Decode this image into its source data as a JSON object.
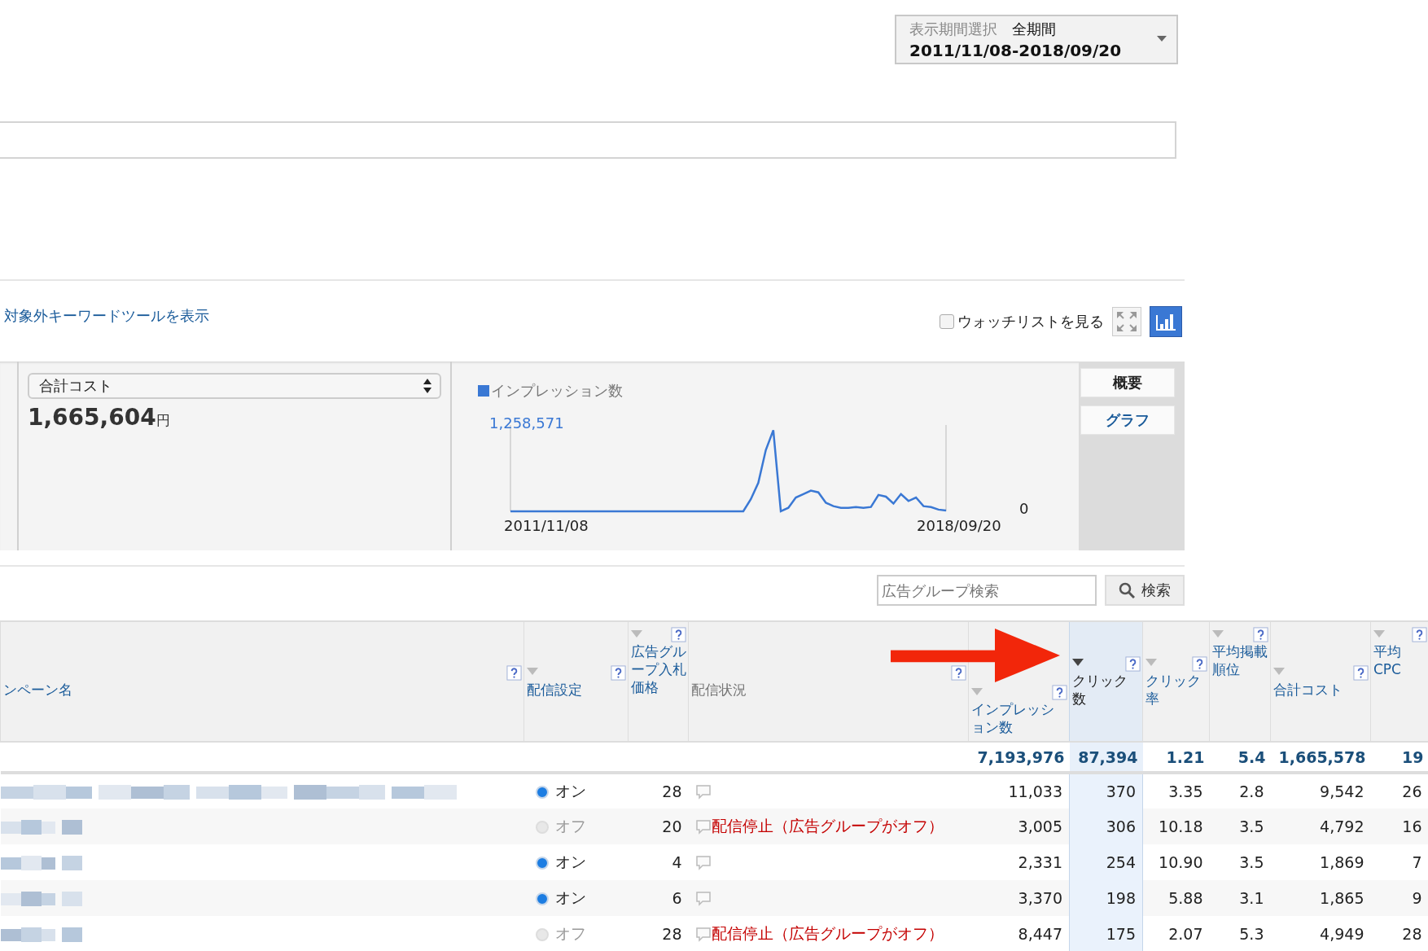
{
  "period_selector": {
    "label": "表示期間選択",
    "value": "全期間",
    "range": "2011/11/08-2018/09/20"
  },
  "keyword_link": "対象外キーワードツールを表示",
  "watchlist": {
    "label": "ウォッチリストを見る",
    "checked": false
  },
  "view_buttons": [
    {
      "kind": "expand",
      "selected": false
    },
    {
      "kind": "chart",
      "selected": true
    }
  ],
  "summary": {
    "metric": "合計コスト",
    "value": "1,665,604",
    "unit": "円"
  },
  "chart": {
    "legend": "インプレッション数",
    "max_label": "1,258,571",
    "min_label": "0",
    "start_label": "2011/11/08",
    "end_label": "2018/09/20"
  },
  "side_tabs": [
    {
      "label": "概要",
      "selected": false
    },
    {
      "label": "グラフ",
      "selected": true
    }
  ],
  "search": {
    "placeholder": "広告グループ検索",
    "button": "検索"
  },
  "table": {
    "columns": [
      {
        "label": "ンペーン名",
        "link": true,
        "sortable": false,
        "sorted": false
      },
      {
        "label": "配信設定",
        "link": true,
        "sortable": true,
        "sorted": false
      },
      {
        "label": "広告グループ入札価格",
        "link": true,
        "sortable": true,
        "sorted": false
      },
      {
        "label": "配信状況",
        "link": false,
        "sortable": false,
        "sorted": false
      },
      {
        "label": "インプレッション数",
        "link": true,
        "sortable": true,
        "sorted": false
      },
      {
        "label": "クリック数",
        "link": true,
        "sortable": true,
        "sorted": true
      },
      {
        "label": "クリック率",
        "link": true,
        "sortable": true,
        "sorted": false
      },
      {
        "label": "平均掲載順位",
        "link": true,
        "sortable": true,
        "sorted": false
      },
      {
        "label": "合計コスト",
        "link": true,
        "sortable": true,
        "sorted": false
      },
      {
        "label": "平均CPC",
        "link": true,
        "sortable": true,
        "sorted": false
      }
    ],
    "totals": [
      "7,193,976",
      "87,394",
      "1.21",
      "5.4",
      "1,665,578",
      "19"
    ],
    "rows": [
      {
        "on": true,
        "setting": "オン",
        "bid": "28",
        "metrics": [
          "11,033",
          "370",
          "3.35",
          "2.8",
          "9,542",
          "26"
        ]
      },
      {
        "on": false,
        "setting": "オフ",
        "bid": "20",
        "status": "配信停止（広告グループがオフ）",
        "metrics": [
          "3,005",
          "306",
          "10.18",
          "3.5",
          "4,792",
          "16"
        ]
      },
      {
        "on": true,
        "setting": "オン",
        "bid": "4",
        "metrics": [
          "2,331",
          "254",
          "10.90",
          "3.5",
          "1,869",
          "7"
        ]
      },
      {
        "on": true,
        "setting": "オン",
        "bid": "6",
        "metrics": [
          "3,370",
          "198",
          "5.88",
          "3.1",
          "1,865",
          "9"
        ]
      },
      {
        "on": false,
        "setting": "オフ",
        "bid": "28",
        "status": "配信停止（広告グループがオフ）",
        "metrics": [
          "8,447",
          "175",
          "2.07",
          "5.3",
          "4,949",
          "28"
        ]
      }
    ]
  }
}
